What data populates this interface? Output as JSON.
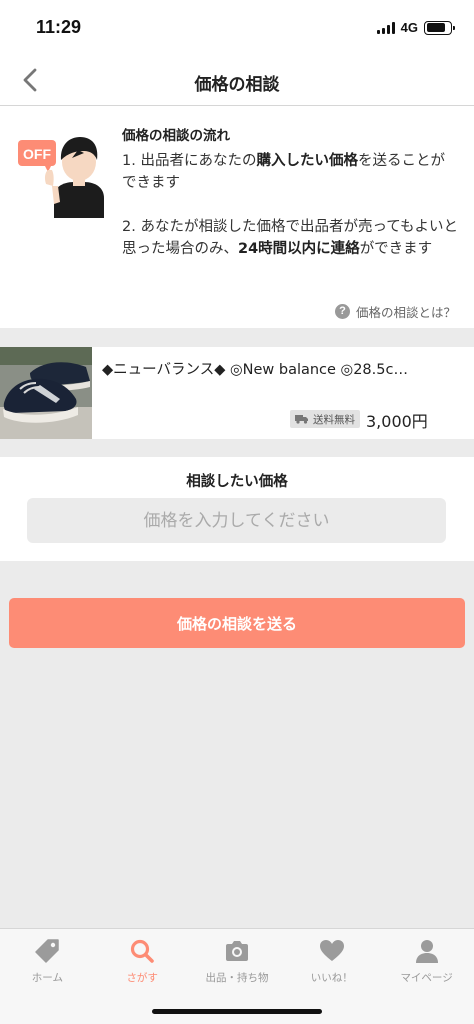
{
  "status_bar": {
    "time": "11:29",
    "network": "4G"
  },
  "nav": {
    "title": "価格の相談"
  },
  "info": {
    "badge": "OFF",
    "heading": "価格の相談の流れ",
    "step1": {
      "pre": "1. 出品者にあなたの",
      "bold": "購入したい価格",
      "post": "を送ることができます"
    },
    "step2": {
      "pre": "2. あなたが相談した価格で出品者が売ってもよいと思った場合のみ、",
      "bold": "24時間以内に連絡",
      "post": "ができます"
    },
    "help_link": "価格の相談とは？",
    "help_icon_glyph": "?"
  },
  "product": {
    "title": "◆ニューバランス◆ ◎New balance ◎28.5c…",
    "shipping_badge": "送料無料",
    "price": "3,000円"
  },
  "price_form": {
    "label": "相談したい価格",
    "input_value": "",
    "input_placeholder": "価格を入力してください",
    "submit_label": "価格の相談を送る"
  },
  "tabs": [
    {
      "label": "ホーム",
      "icon": "tag-icon",
      "active": false
    },
    {
      "label": "さがす",
      "icon": "search-icon",
      "active": true
    },
    {
      "label": "出品・持ち物",
      "icon": "camera-icon",
      "active": false
    },
    {
      "label": "いいね！",
      "icon": "heart-icon",
      "active": false
    },
    {
      "label": "マイページ",
      "icon": "person-icon",
      "active": false
    }
  ],
  "colors": {
    "accent": "#fd8c75",
    "tab_inactive": "#999999",
    "badge_orange": "#fd8c75"
  }
}
